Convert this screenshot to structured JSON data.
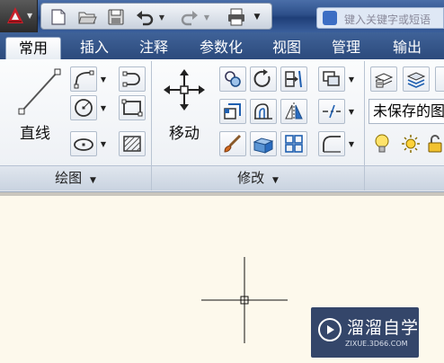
{
  "search": {
    "text": "键入关键字或短语"
  },
  "tabs": [
    "常用",
    "插入",
    "注释",
    "参数化",
    "视图",
    "管理",
    "输出"
  ],
  "panels": {
    "draw": {
      "title": "绘图",
      "line_label": "直线"
    },
    "modify": {
      "title": "修改",
      "move_label": "移动"
    }
  },
  "layer": {
    "current_value": "未保存的图"
  },
  "watermark": {
    "title": "溜溜自学",
    "url": "ZIXUE.3D66.COM"
  }
}
